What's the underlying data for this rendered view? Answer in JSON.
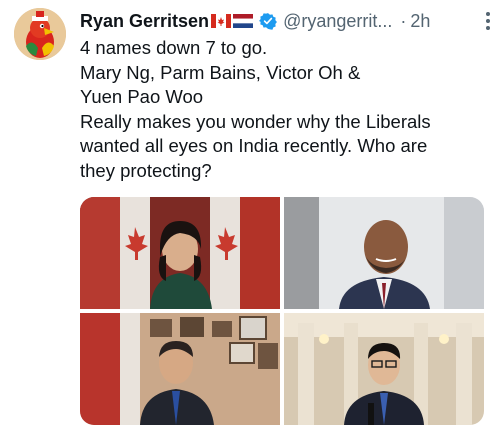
{
  "tweet": {
    "author_name": "Ryan Gerritsen",
    "flags": [
      "flag-canada-icon",
      "flag-netherlands-icon"
    ],
    "handle": "@ryangerrit...",
    "separator": "·",
    "time": "2h",
    "text_lines": [
      "4 names down 7 to go.",
      "Mary Ng, Parm Bains, Victor Oh &",
      "Yuen Pao Woo",
      "Really makes you wonder why the Liberals",
      "wanted all eyes on India recently. Who are",
      "they protecting?"
    ],
    "media": [
      {
        "name": "photo-woman-with-flags",
        "icon": "photo"
      },
      {
        "name": "photo-bald-man-suit",
        "icon": "photo"
      },
      {
        "name": "photo-older-man-office",
        "icon": "photo"
      },
      {
        "name": "photo-man-glasses-hall",
        "icon": "photo"
      }
    ]
  },
  "colors": {
    "text": "#0f1419",
    "secondary": "#536471",
    "verified": "#1d9bf0"
  }
}
